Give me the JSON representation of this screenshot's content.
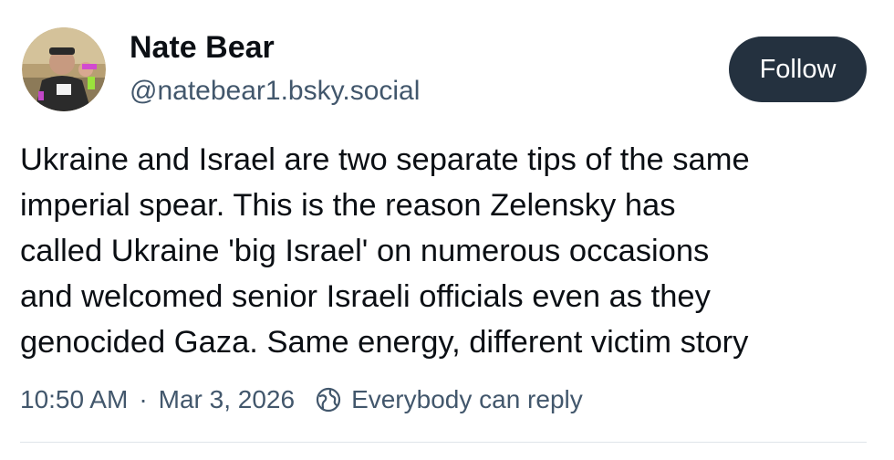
{
  "author": {
    "display_name": "Nate Bear",
    "handle": "@natebear1.bsky.social"
  },
  "follow_button": {
    "label": "Follow"
  },
  "post": {
    "text": "Ukraine and Israel are two separate tips of the same\nimperial spear. This is the reason Zelensky has\ncalled Ukraine 'big Israel' on numerous occasions\nand welcomed senior Israeli officials even as they\ngenocided Gaza. Same energy, different victim story"
  },
  "meta": {
    "time": "10:50 AM",
    "separator": "·",
    "date": "Mar 3, 2026",
    "reply_setting": "Everybody can reply",
    "reply_icon": "globe-icon"
  },
  "colors": {
    "follow_bg": "#24313f",
    "muted_text": "#42576c",
    "divider": "#dfe4ea"
  }
}
